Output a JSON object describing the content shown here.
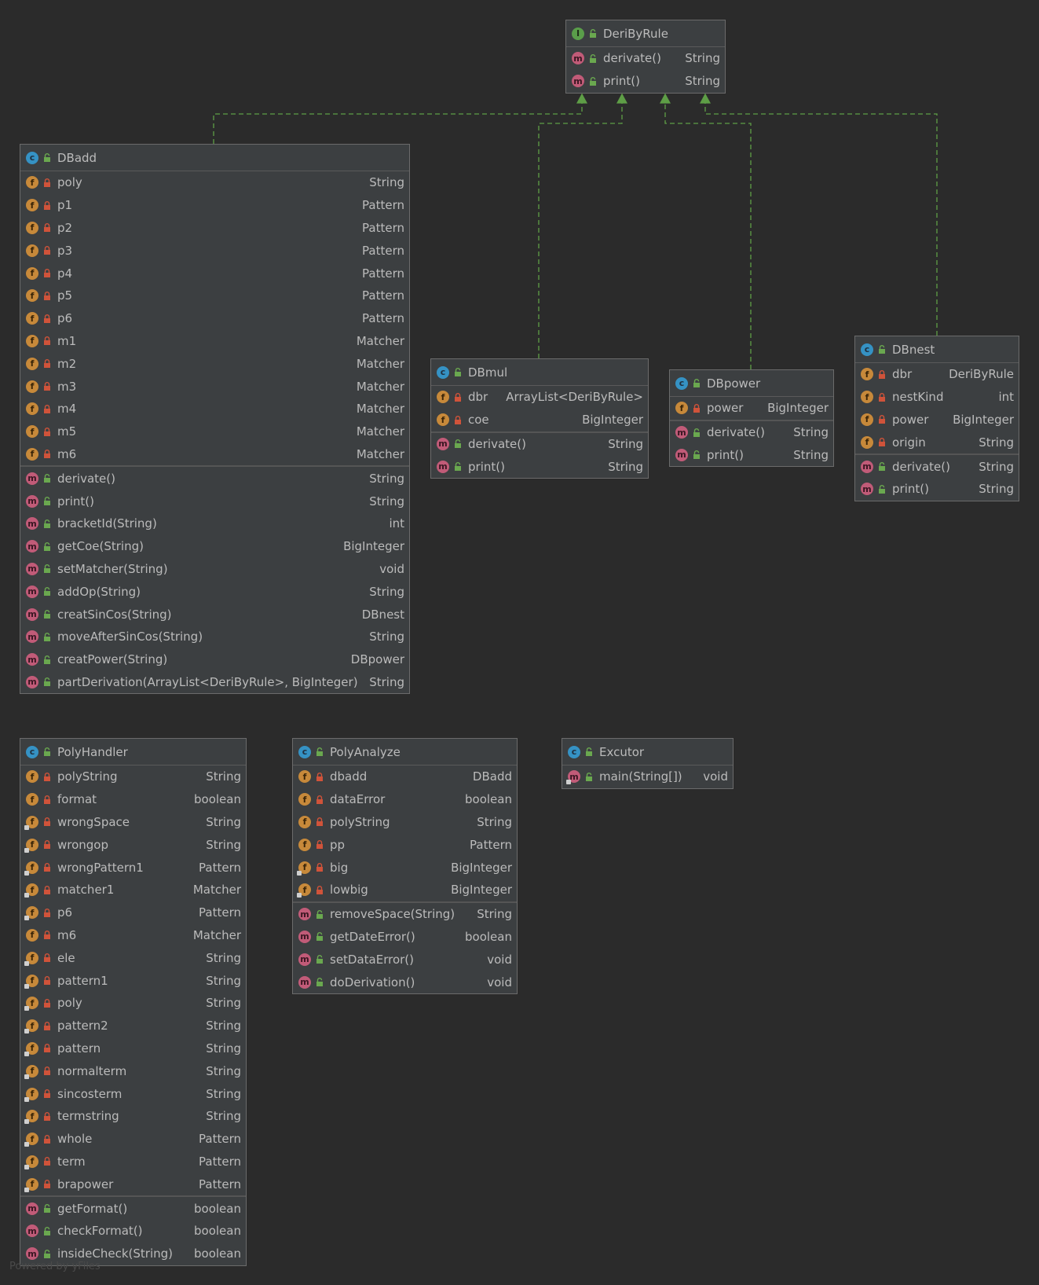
{
  "watermark": "Powered by yFiles",
  "nodes": [
    {
      "id": "DeriByRule",
      "kind": "interface",
      "title": "DeriByRule",
      "sections": [
        [
          {
            "icon": "method",
            "vis": "public",
            "name": "derivate()",
            "type": "String"
          },
          {
            "icon": "method",
            "vis": "public",
            "name": "print()",
            "type": "String"
          }
        ]
      ]
    },
    {
      "id": "DBadd",
      "kind": "class",
      "title": "DBadd",
      "sections": [
        [
          {
            "icon": "field",
            "vis": "private",
            "name": "poly",
            "type": "String"
          },
          {
            "icon": "field",
            "vis": "private",
            "name": "p1",
            "type": "Pattern"
          },
          {
            "icon": "field",
            "vis": "private",
            "name": "p2",
            "type": "Pattern"
          },
          {
            "icon": "field",
            "vis": "private",
            "name": "p3",
            "type": "Pattern"
          },
          {
            "icon": "field",
            "vis": "private",
            "name": "p4",
            "type": "Pattern"
          },
          {
            "icon": "field",
            "vis": "private",
            "name": "p5",
            "type": "Pattern"
          },
          {
            "icon": "field",
            "vis": "private",
            "name": "p6",
            "type": "Pattern"
          },
          {
            "icon": "field",
            "vis": "private",
            "name": "m1",
            "type": "Matcher"
          },
          {
            "icon": "field",
            "vis": "private",
            "name": "m2",
            "type": "Matcher"
          },
          {
            "icon": "field",
            "vis": "private",
            "name": "m3",
            "type": "Matcher"
          },
          {
            "icon": "field",
            "vis": "private",
            "name": "m4",
            "type": "Matcher"
          },
          {
            "icon": "field",
            "vis": "private",
            "name": "m5",
            "type": "Matcher"
          },
          {
            "icon": "field",
            "vis": "private",
            "name": "m6",
            "type": "Matcher"
          }
        ],
        [
          {
            "icon": "method",
            "vis": "public",
            "name": "derivate()",
            "type": "String"
          },
          {
            "icon": "method",
            "vis": "public",
            "name": "print()",
            "type": "String"
          },
          {
            "icon": "method",
            "vis": "public",
            "name": "bracketId(String)",
            "type": "int"
          },
          {
            "icon": "method",
            "vis": "public",
            "name": "getCoe(String)",
            "type": "BigInteger"
          },
          {
            "icon": "method",
            "vis": "public",
            "name": "setMatcher(String)",
            "type": "void"
          },
          {
            "icon": "method",
            "vis": "public",
            "name": "addOp(String)",
            "type": "String"
          },
          {
            "icon": "method",
            "vis": "public",
            "name": "creatSinCos(String)",
            "type": "DBnest"
          },
          {
            "icon": "method",
            "vis": "public",
            "name": "moveAfterSinCos(String)",
            "type": "String"
          },
          {
            "icon": "method",
            "vis": "public",
            "name": "creatPower(String)",
            "type": "DBpower"
          },
          {
            "icon": "method",
            "vis": "public",
            "name": "partDerivation(ArrayList<DeriByRule>, BigInteger)",
            "type": "String"
          }
        ]
      ]
    },
    {
      "id": "DBmul",
      "kind": "class",
      "title": "DBmul",
      "sections": [
        [
          {
            "icon": "field",
            "vis": "private",
            "name": "dbr",
            "type": "ArrayList<DeriByRule>"
          },
          {
            "icon": "field",
            "vis": "private",
            "name": "coe",
            "type": "BigInteger"
          }
        ],
        [
          {
            "icon": "method",
            "vis": "public",
            "name": "derivate()",
            "type": "String"
          },
          {
            "icon": "method",
            "vis": "public",
            "name": "print()",
            "type": "String"
          }
        ]
      ]
    },
    {
      "id": "DBpower",
      "kind": "class",
      "title": "DBpower",
      "sections": [
        [
          {
            "icon": "field",
            "vis": "private",
            "name": "power",
            "type": "BigInteger"
          }
        ],
        [
          {
            "icon": "method",
            "vis": "public",
            "name": "derivate()",
            "type": "String"
          },
          {
            "icon": "method",
            "vis": "public",
            "name": "print()",
            "type": "String"
          }
        ]
      ]
    },
    {
      "id": "DBnest",
      "kind": "class",
      "title": "DBnest",
      "sections": [
        [
          {
            "icon": "field",
            "vis": "private",
            "name": "dbr",
            "type": "DeriByRule"
          },
          {
            "icon": "field",
            "vis": "private",
            "name": "nestKind",
            "type": "int"
          },
          {
            "icon": "field",
            "vis": "private",
            "name": "power",
            "type": "BigInteger"
          },
          {
            "icon": "field",
            "vis": "private",
            "name": "origin",
            "type": "String"
          }
        ],
        [
          {
            "icon": "method",
            "vis": "public",
            "name": "derivate()",
            "type": "String"
          },
          {
            "icon": "method",
            "vis": "public",
            "name": "print()",
            "type": "String"
          }
        ]
      ]
    },
    {
      "id": "PolyHandler",
      "kind": "class",
      "title": "PolyHandler",
      "sections": [
        [
          {
            "icon": "field",
            "vis": "private",
            "name": "polyString",
            "type": "String"
          },
          {
            "icon": "field",
            "vis": "private",
            "name": "format",
            "type": "boolean"
          },
          {
            "icon": "field-final",
            "vis": "private",
            "name": "wrongSpace",
            "type": "String"
          },
          {
            "icon": "field-final",
            "vis": "private",
            "name": "wrongop",
            "type": "String"
          },
          {
            "icon": "field-final",
            "vis": "private",
            "name": "wrongPattern1",
            "type": "Pattern"
          },
          {
            "icon": "field-final",
            "vis": "private",
            "name": "matcher1",
            "type": "Matcher"
          },
          {
            "icon": "field-final",
            "vis": "private",
            "name": "p6",
            "type": "Pattern"
          },
          {
            "icon": "field",
            "vis": "private",
            "name": "m6",
            "type": "Matcher"
          },
          {
            "icon": "field-final",
            "vis": "private",
            "name": "ele",
            "type": "String"
          },
          {
            "icon": "field-final",
            "vis": "private",
            "name": "pattern1",
            "type": "String"
          },
          {
            "icon": "field-final",
            "vis": "private",
            "name": "poly",
            "type": "String"
          },
          {
            "icon": "field-final",
            "vis": "private",
            "name": "pattern2",
            "type": "String"
          },
          {
            "icon": "field-final",
            "vis": "private",
            "name": "pattern",
            "type": "String"
          },
          {
            "icon": "field-final",
            "vis": "private",
            "name": "normalterm",
            "type": "String"
          },
          {
            "icon": "field-final",
            "vis": "private",
            "name": "sincosterm",
            "type": "String"
          },
          {
            "icon": "field-final",
            "vis": "private",
            "name": "termstring",
            "type": "String"
          },
          {
            "icon": "field-final",
            "vis": "private",
            "name": "whole",
            "type": "Pattern"
          },
          {
            "icon": "field-final",
            "vis": "private",
            "name": "term",
            "type": "Pattern"
          },
          {
            "icon": "field-final",
            "vis": "private",
            "name": "brapower",
            "type": "Pattern"
          }
        ],
        [
          {
            "icon": "method",
            "vis": "public",
            "name": "getFormat()",
            "type": "boolean"
          },
          {
            "icon": "method",
            "vis": "public",
            "name": "checkFormat()",
            "type": "boolean"
          },
          {
            "icon": "method",
            "vis": "public",
            "name": "insideCheck(String)",
            "type": "boolean"
          }
        ]
      ]
    },
    {
      "id": "PolyAnalyze",
      "kind": "class",
      "title": "PolyAnalyze",
      "sections": [
        [
          {
            "icon": "field",
            "vis": "private",
            "name": "dbadd",
            "type": "DBadd"
          },
          {
            "icon": "field",
            "vis": "private",
            "name": "dataError",
            "type": "boolean"
          },
          {
            "icon": "field",
            "vis": "private",
            "name": "polyString",
            "type": "String"
          },
          {
            "icon": "field",
            "vis": "private",
            "name": "pp",
            "type": "Pattern"
          },
          {
            "icon": "field-final",
            "vis": "private",
            "name": "big",
            "type": "BigInteger"
          },
          {
            "icon": "field-final",
            "vis": "private",
            "name": "lowbig",
            "type": "BigInteger"
          }
        ],
        [
          {
            "icon": "method",
            "vis": "public",
            "name": "removeSpace(String)",
            "type": "String"
          },
          {
            "icon": "method",
            "vis": "public",
            "name": "getDateError()",
            "type": "boolean"
          },
          {
            "icon": "method",
            "vis": "public",
            "name": "setDataError()",
            "type": "void"
          },
          {
            "icon": "method",
            "vis": "public",
            "name": "doDerivation()",
            "type": "void"
          }
        ]
      ]
    },
    {
      "id": "Excutor",
      "kind": "class",
      "title": "Excutor",
      "sections": [
        [
          {
            "icon": "method-static",
            "vis": "public",
            "name": "main(String[])",
            "type": "void"
          }
        ]
      ]
    }
  ],
  "edges": [
    {
      "from": "DBadd",
      "to": "DeriByRule",
      "style": "dashed",
      "arrow": "implements"
    },
    {
      "from": "DBmul",
      "to": "DeriByRule",
      "style": "dashed",
      "arrow": "implements"
    },
    {
      "from": "DBpower",
      "to": "DeriByRule",
      "style": "dashed",
      "arrow": "implements"
    },
    {
      "from": "DBnest",
      "to": "DeriByRule",
      "style": "dashed",
      "arrow": "implements"
    }
  ],
  "colors": {
    "background": "#2b2b2b",
    "edge": "#5e9e46",
    "class_icon": "#3592c4",
    "interface_icon": "#5a9e4a",
    "field_icon": "#c7893a",
    "method_icon": "#c15b78",
    "private_lock": "#d0533a",
    "public_lock": "#6aa84f"
  }
}
